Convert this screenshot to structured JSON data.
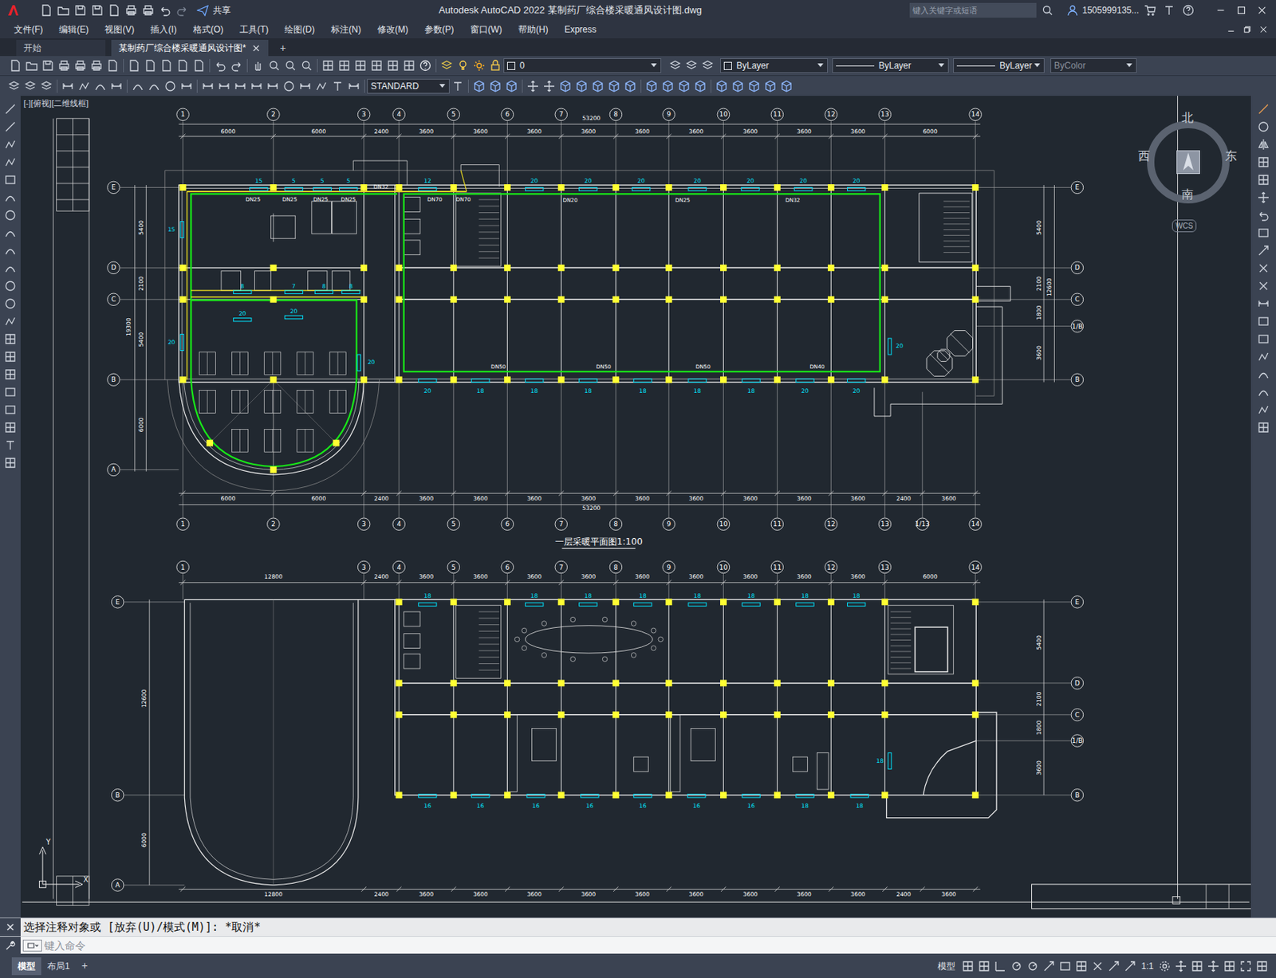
{
  "window": {
    "title": "Autodesk AutoCAD 2022    某制药厂综合楼采暖通风设计图.dwg",
    "share": "共享",
    "search_placeholder": "键入关键字或短语",
    "user": "1505999135..."
  },
  "menu": [
    "文件(F)",
    "编辑(E)",
    "视图(V)",
    "插入(I)",
    "格式(O)",
    "工具(T)",
    "绘图(D)",
    "标注(N)",
    "修改(M)",
    "参数(P)",
    "窗口(W)",
    "帮助(H)",
    "Express"
  ],
  "tabs": [
    {
      "label": "开始",
      "selected": false
    },
    {
      "label": "某制药厂综合楼采暖通风设计图*",
      "selected": true
    }
  ],
  "new_tab": "+",
  "toolbar": {
    "layer": "0",
    "color": "ByLayer",
    "linetype": "ByLayer",
    "lineweight": "ByLayer",
    "plotstyle": {
      "value": "ByColor",
      "disabled": true
    },
    "textstyle": "STANDARD"
  },
  "viewport": {
    "label": "[-][俯视][二维线框]",
    "viewcube": {
      "north": "北",
      "south": "南",
      "east": "东",
      "west": "西",
      "ucs": "WCS"
    }
  },
  "drawing": {
    "title": "一层采暖平面图1:100",
    "ucs": {
      "y": "Y",
      "x": "X"
    },
    "plan1": {
      "col_axes_top": [
        "1",
        "2",
        "3",
        "4",
        "5",
        "6",
        "7",
        "8",
        "9",
        "10",
        "11",
        "12",
        "13",
        "14"
      ],
      "col_axes_bottom": [
        "1",
        "2",
        "3",
        "4",
        "5",
        "6",
        "7",
        "8",
        "9",
        "10",
        "11",
        "12",
        "13",
        "1/13",
        "14"
      ],
      "row_axes_left": [
        "E",
        "D",
        "C",
        "B",
        "A"
      ],
      "row_axes_right": [
        "E",
        "D",
        "C",
        "1/B",
        "B"
      ],
      "dims_top": [
        "6000",
        "6000",
        "2400",
        "3600",
        "3600",
        "3600",
        "3600",
        "3600",
        "3600",
        "3600",
        "3600",
        "3600",
        "6000"
      ],
      "total_top": "53200",
      "dims_bottom": [
        "6000",
        "6000",
        "2400",
        "3600",
        "3600",
        "3600",
        "3600",
        "3600",
        "3600",
        "3600",
        "3600",
        "3600",
        "2400",
        "3600"
      ],
      "total_bottom": "53200",
      "dims_left": [
        "5400",
        "2100",
        "5400",
        "6000"
      ],
      "total_left": "19300",
      "dims_right": [
        "5400",
        "2100",
        "1800",
        "3600"
      ],
      "total_right": "12600",
      "radiators": [
        "15",
        "5",
        "5",
        "5",
        "12",
        "20",
        "20",
        "20",
        "20",
        "20",
        "20",
        "20",
        "20",
        "18",
        "18",
        "18",
        "18",
        "18",
        "18",
        "20",
        "20",
        "15",
        "20",
        "20",
        "20",
        "8",
        "7",
        "8",
        "8",
        "20",
        "20"
      ],
      "pipes": [
        "DN25",
        "DN25",
        "DN25",
        "DN25",
        "DN32",
        "DN70",
        "DN70",
        "DN20",
        "DN25",
        "DN32",
        "DN50",
        "DN50",
        "DN50",
        "DN40"
      ]
    },
    "plan2": {
      "col_axes_top": [
        "1",
        "3",
        "4",
        "5",
        "6",
        "7",
        "8",
        "9",
        "10",
        "11",
        "12",
        "13",
        "14"
      ],
      "row_axes_left": [
        "E",
        "B",
        "A"
      ],
      "row_axes_right": [
        "E",
        "D",
        "C",
        "1/B",
        "B"
      ],
      "dims_top": [
        "12800",
        "2400",
        "3600",
        "3600",
        "3600",
        "3600",
        "3600",
        "3600",
        "3600",
        "3600",
        "3600",
        "6000"
      ],
      "dims_bottom": [
        "12800",
        "2400",
        "3600",
        "3600",
        "3600",
        "3600",
        "3600",
        "3600",
        "3600",
        "3600",
        "3600",
        "2400",
        "3600"
      ],
      "dims_left": [
        "12600",
        "6000"
      ],
      "dims_right": [
        "5400",
        "2100",
        "1800",
        "3600"
      ],
      "radiators": [
        "18",
        "18",
        "18",
        "18",
        "18",
        "18",
        "18",
        "18",
        "16",
        "16",
        "16",
        "16",
        "16",
        "16",
        "16",
        "18",
        "18",
        "18"
      ]
    }
  },
  "command": {
    "history": "选择注释对象或 [放弃(U)/模式(M)]: *取消*",
    "placeholder": "键入命令"
  },
  "status_bar": {
    "layouts": [
      {
        "label": "模型",
        "selected": true
      },
      {
        "label": "布局1",
        "selected": false
      }
    ],
    "add": "+",
    "space": "模型",
    "scale": "1:1"
  }
}
